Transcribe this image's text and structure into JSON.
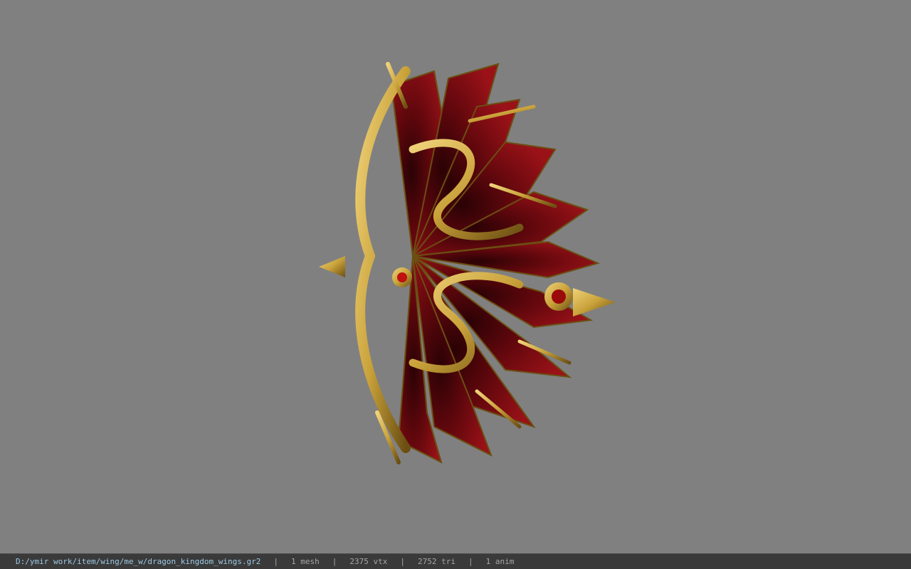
{
  "viewer": {
    "background_color": "#808080",
    "model": {
      "icon": "dragon-wings-model",
      "colors": {
        "gold": "#c9a23a",
        "gold_dark": "#6b4e12",
        "crimson": "#8e0f14",
        "crimson_dark": "#3a0307",
        "gem": "#c01010"
      }
    }
  },
  "statusbar": {
    "path": "D:/ymir work/item/wing/me_w/dragon_kingdom_wings.gr2",
    "separator": "|",
    "mesh": "1 mesh",
    "vtx": "2375 vtx",
    "tri": "2752 tri",
    "anim": "1 anim"
  }
}
